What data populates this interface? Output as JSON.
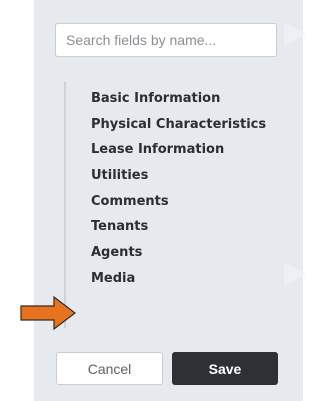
{
  "search": {
    "placeholder": "Search fields by name..."
  },
  "nav": {
    "items": [
      {
        "label": "Basic Information"
      },
      {
        "label": "Physical Characteristics"
      },
      {
        "label": "Lease Information"
      },
      {
        "label": "Utilities"
      },
      {
        "label": "Comments"
      },
      {
        "label": "Tenants"
      },
      {
        "label": "Agents"
      },
      {
        "label": "Media"
      }
    ]
  },
  "footer": {
    "cancel_label": "Cancel",
    "save_label": "Save"
  },
  "annotation": {
    "icon": "arrow-right-icon",
    "color": "#e8731f"
  }
}
